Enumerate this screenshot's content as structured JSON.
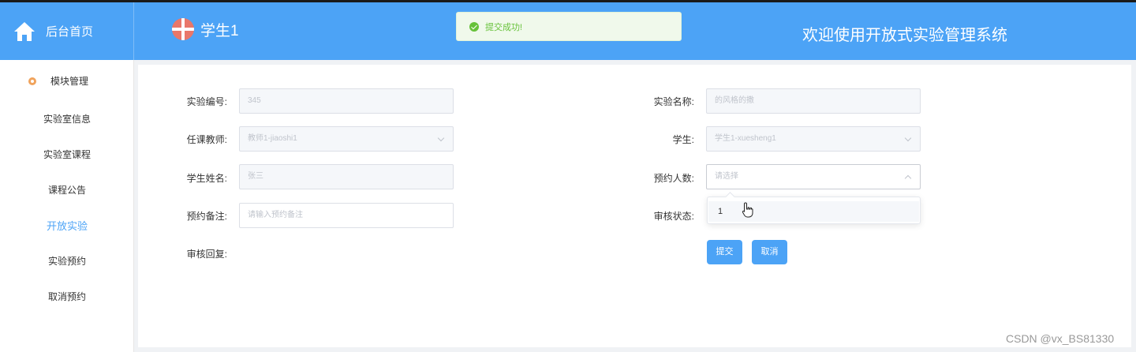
{
  "header": {
    "brand_label": "后台首页",
    "user_name": "学生1",
    "site_title": "欢迎使用开放式实验管理系统",
    "toast": "提交成功!"
  },
  "sidebar": {
    "section_label": "模块管理",
    "items": [
      {
        "label": "实验室信息"
      },
      {
        "label": "实验室课程"
      },
      {
        "label": "课程公告"
      },
      {
        "label": "开放实验"
      },
      {
        "label": "实验预约"
      },
      {
        "label": "取消预约"
      }
    ]
  },
  "form": {
    "exp_no_label": "实验编号:",
    "exp_no_value": "345",
    "exp_name_label": "实验名称:",
    "exp_name_value": "的风格的撒",
    "teacher_label": "任课教师:",
    "teacher_value": "教师1-jiaoshi1",
    "student_label": "学生:",
    "student_value": "学生1-xuesheng1",
    "student_name_label": "学生姓名:",
    "student_name_value": "张三",
    "people_label": "预约人数:",
    "people_placeholder": "请选择",
    "people_option": "1",
    "remark_label": "预约备注:",
    "remark_placeholder": "请输入预约备注",
    "review_status_label": "审核状态:",
    "review_reply_label": "审核回复:",
    "submit_label": "提交",
    "cancel_label": "取消"
  },
  "watermark": "CSDN @vx_BS81330",
  "colors": {
    "primary": "#4ca3f6",
    "success": "#67c23a",
    "avatar": "#e9776a"
  }
}
